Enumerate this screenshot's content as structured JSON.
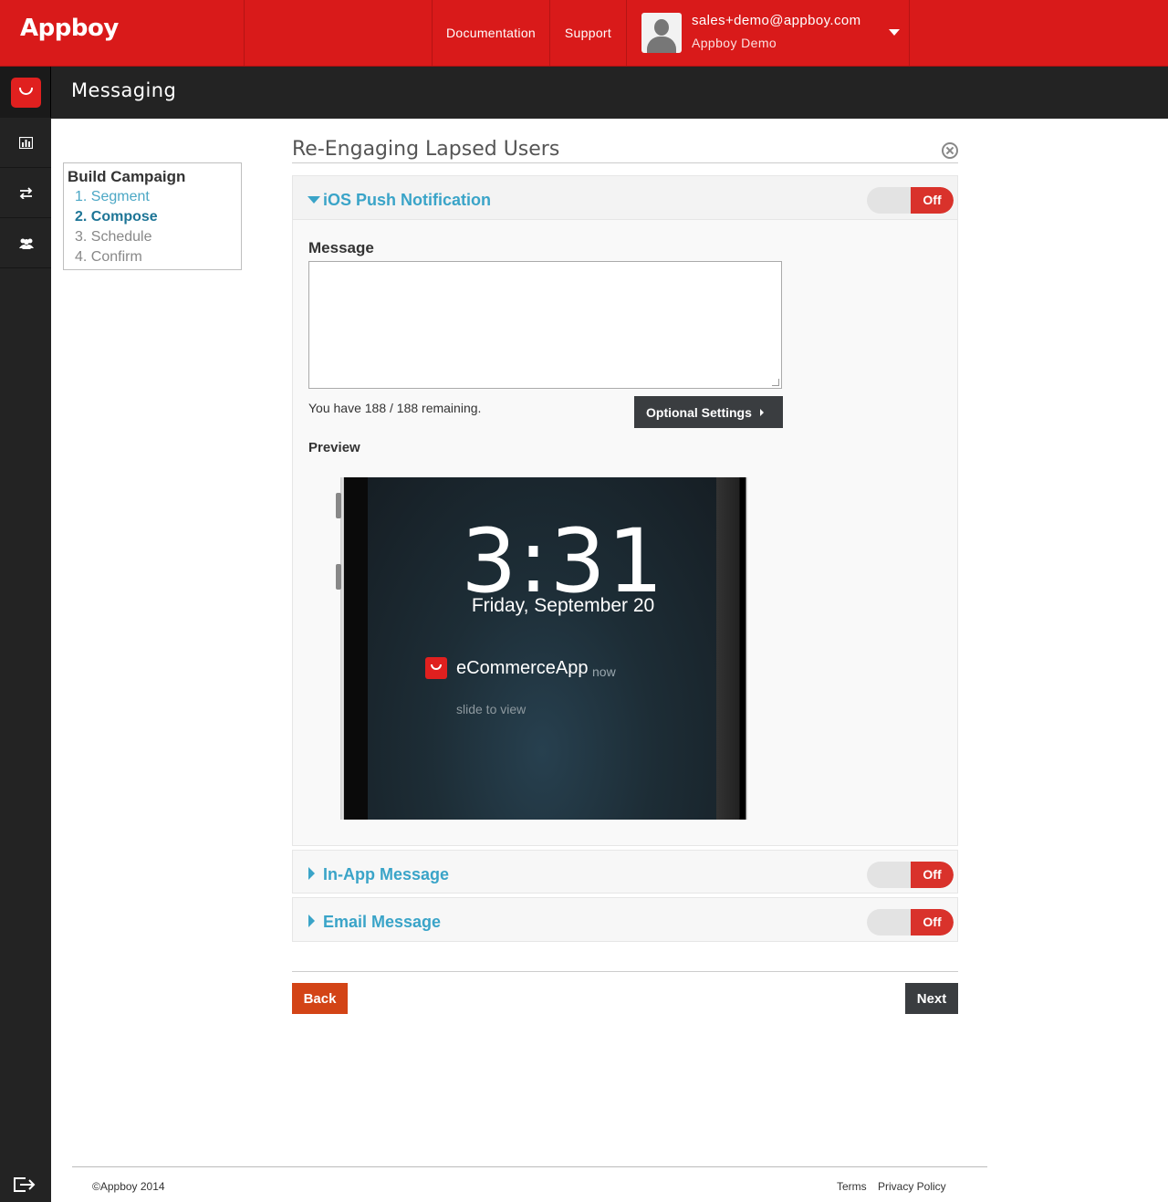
{
  "header": {
    "logo": "Appboy",
    "nav": {
      "documentation": "Documentation",
      "support": "Support"
    },
    "user": {
      "email": "sales+demo@appboy.com",
      "org": "Appboy Demo"
    }
  },
  "page": {
    "title": "Messaging"
  },
  "steps": {
    "title": "Build Campaign",
    "items": [
      "1. Segment",
      "2. Compose",
      "3. Schedule",
      "4. Confirm"
    ],
    "active": "2. Compose"
  },
  "campaign": {
    "name": "Re-Engaging Lapsed Users"
  },
  "ios_push": {
    "title": "iOS Push Notification",
    "toggle": "Off",
    "message_label": "Message",
    "message_value": "",
    "remaining": "You have 188 / 188 remaining.",
    "optional_settings": "Optional Settings",
    "preview_label": "Preview",
    "preview": {
      "time": "3:31",
      "date": "Friday, September 20",
      "app_name": "eCommerceApp",
      "app_time": "now",
      "slide": "slide to view"
    }
  },
  "in_app": {
    "title": "In-App Message",
    "toggle": "Off"
  },
  "email": {
    "title": "Email Message",
    "toggle": "Off"
  },
  "actions": {
    "back": "Back",
    "next": "Next"
  },
  "footer": {
    "copyright": "©Appboy 2014",
    "terms": "Terms",
    "privacy": "Privacy Policy"
  },
  "colors": {
    "brand_red": "#d91a1a",
    "accent_blue": "#3aa4c8",
    "dark": "#232323"
  }
}
